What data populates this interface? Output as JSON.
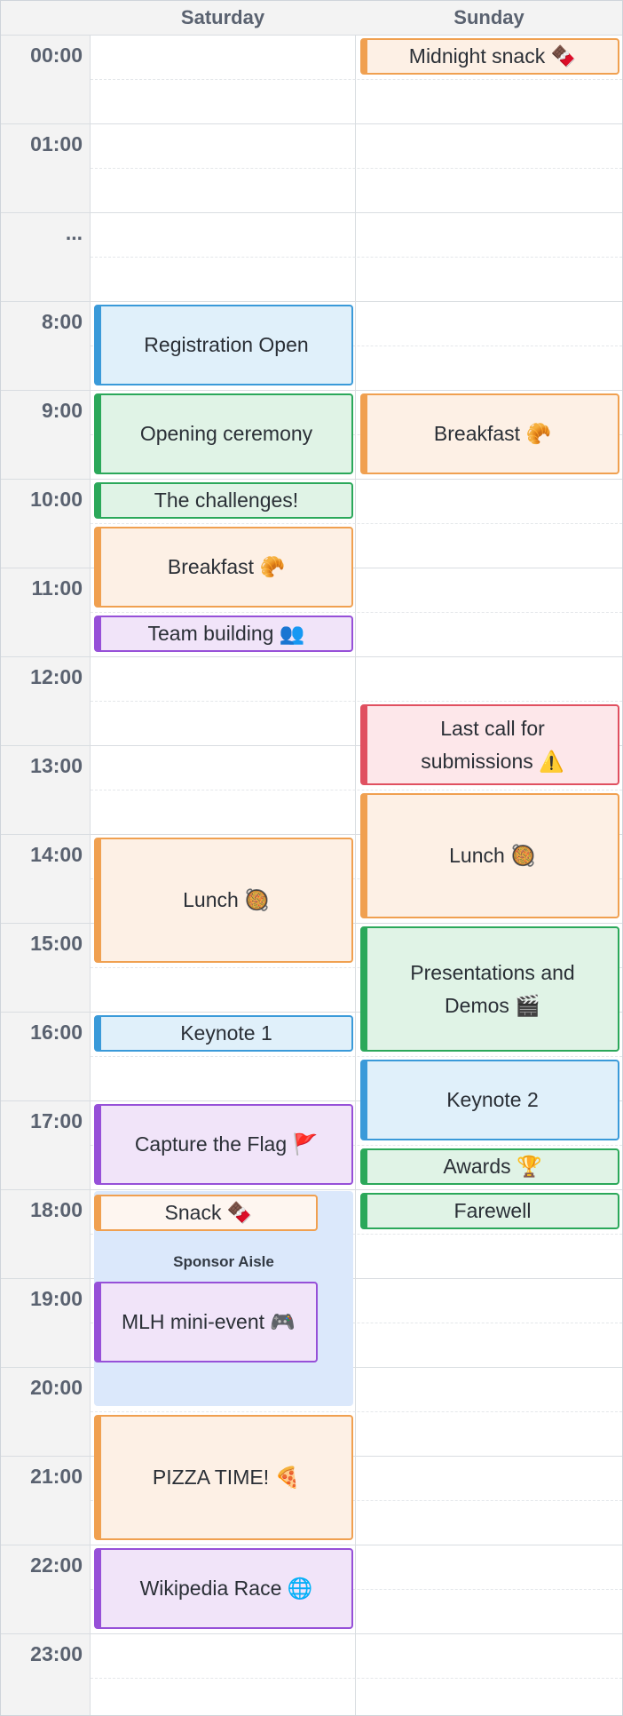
{
  "days": [
    "Saturday",
    "Sunday"
  ],
  "time_labels": [
    "00:00",
    "01:00",
    "...",
    "8:00",
    "9:00",
    "10:00",
    "11:00",
    "12:00",
    "13:00",
    "14:00",
    "15:00",
    "16:00",
    "17:00",
    "18:00",
    "19:00",
    "20:00",
    "21:00",
    "22:00",
    "23:00"
  ],
  "sponsor_aisle": {
    "label": "Sponsor Aisle"
  },
  "saturday_events": [
    {
      "id": "registration-open",
      "title": "Registration Open",
      "color": "blue"
    },
    {
      "id": "opening-ceremony",
      "title": "Opening ceremony",
      "color": "green"
    },
    {
      "id": "the-challenges",
      "title": "The challenges!",
      "color": "green"
    },
    {
      "id": "breakfast",
      "title": "Breakfast 🥐",
      "color": "orange"
    },
    {
      "id": "team-building",
      "title": "Team building 👥",
      "color": "purple"
    },
    {
      "id": "lunch",
      "title": "Lunch 🥘",
      "color": "orange"
    },
    {
      "id": "keynote-1",
      "title": "Keynote 1",
      "color": "blue"
    },
    {
      "id": "capture-the-flag",
      "title": "Capture the Flag 🚩",
      "color": "purple"
    },
    {
      "id": "snack",
      "title": "Snack 🍫",
      "color": "light-orange"
    },
    {
      "id": "mlh-mini-event",
      "title": "MLH mini-event 🎮",
      "color": "purple"
    },
    {
      "id": "pizza-time",
      "title": "PIZZA TIME! 🍕",
      "color": "orange"
    },
    {
      "id": "wikipedia-race",
      "title": "Wikipedia Race 🌐",
      "color": "purple"
    }
  ],
  "sunday_events": [
    {
      "id": "midnight-snack",
      "title": "Midnight snack 🍫",
      "color": "orange"
    },
    {
      "id": "breakfast",
      "title": "Breakfast 🥐",
      "color": "orange"
    },
    {
      "id": "last-call",
      "title": "Last call for submissions ⚠️",
      "color": "red"
    },
    {
      "id": "lunch",
      "title": "Lunch 🥘",
      "color": "orange"
    },
    {
      "id": "presentations-and-demos",
      "title": "Presentations and Demos 🎬",
      "color": "green"
    },
    {
      "id": "keynote-2",
      "title": "Keynote 2",
      "color": "blue"
    },
    {
      "id": "awards",
      "title": "Awards 🏆",
      "color": "green"
    },
    {
      "id": "farewell",
      "title": "Farewell",
      "color": "green"
    }
  ],
  "colors": {
    "blue": "#3a9ad9",
    "green": "#2ba85a",
    "orange": "#f0a050",
    "purple": "#9650d8",
    "red": "#e05060",
    "sponsor": "#dbe8fb"
  }
}
